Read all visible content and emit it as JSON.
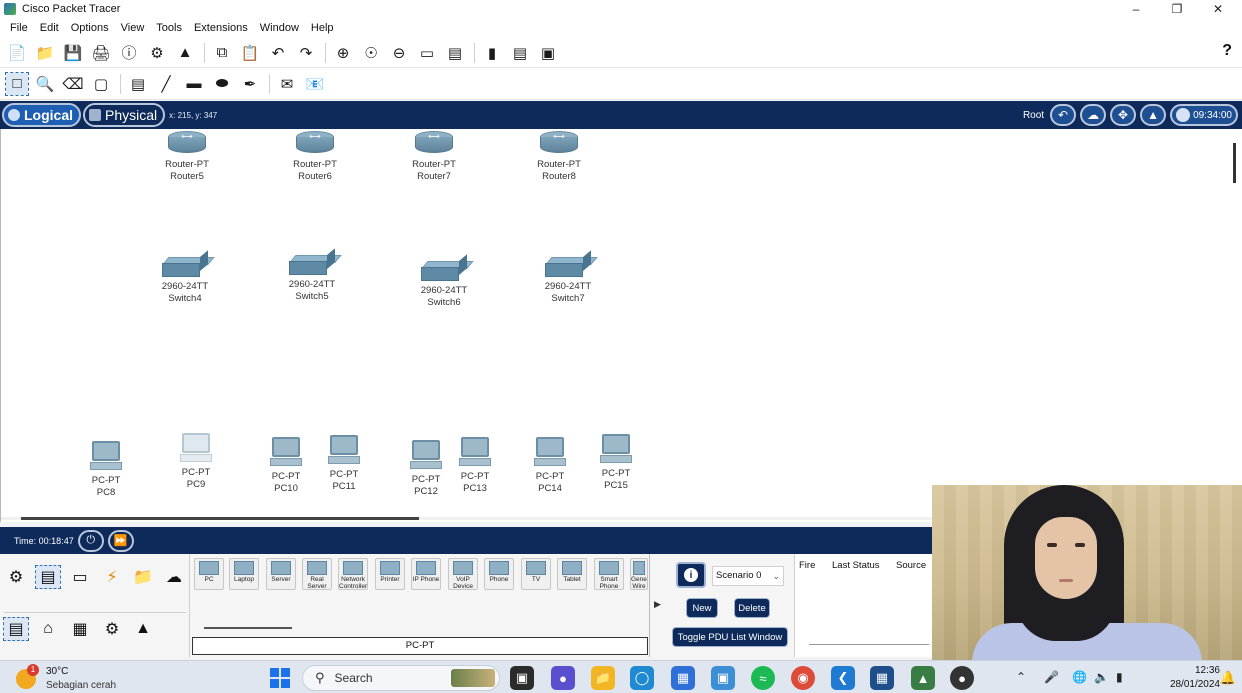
{
  "window": {
    "title": "Cisco Packet Tracer",
    "controls": [
      "–",
      "❐",
      "✕"
    ]
  },
  "menu": [
    "File",
    "Edit",
    "Options",
    "View",
    "Tools",
    "Extensions",
    "Window",
    "Help"
  ],
  "toolbar": {
    "help": "?"
  },
  "logical_bar": {
    "logical_label": "Logical",
    "physical_label": "Physical",
    "coords": "x: 215, y: 347",
    "root_label": "Root",
    "clock": "09:34:00"
  },
  "workspace": {
    "routers": [
      {
        "model": "Router-PT",
        "name": "Router5"
      },
      {
        "model": "Router-PT",
        "name": "Router6"
      },
      {
        "model": "Router-PT",
        "name": "Router7"
      },
      {
        "model": "Router-PT",
        "name": "Router8"
      }
    ],
    "switches": [
      {
        "model": "2960-24TT",
        "name": "Switch4"
      },
      {
        "model": "2960-24TT",
        "name": "Switch5"
      },
      {
        "model": "2960-24TT",
        "name": "Switch6"
      },
      {
        "model": "2960-24TT",
        "name": "Switch7"
      }
    ],
    "pcs": [
      {
        "model": "PC-PT",
        "name": "PC8"
      },
      {
        "model": "PC-PT",
        "name": "PC9"
      },
      {
        "model": "PC-PT",
        "name": "PC10"
      },
      {
        "model": "PC-PT",
        "name": "PC11"
      },
      {
        "model": "PC-PT",
        "name": "PC12"
      },
      {
        "model": "PC-PT",
        "name": "PC13"
      },
      {
        "model": "PC-PT",
        "name": "PC14"
      },
      {
        "model": "PC-PT",
        "name": "PC15"
      }
    ]
  },
  "timebar": {
    "time": "Time: 00:18:47"
  },
  "device_strip": {
    "tiles": [
      "PC",
      "Laptop",
      "Server",
      "Real Server",
      "Network Controller",
      "Printer",
      "IP Phone",
      "VoIP Device",
      "Phone",
      "TV",
      "Tablet",
      "Smart Phone",
      "Generic Wire"
    ],
    "selected_caption": "PC-PT"
  },
  "pdu": {
    "scenario": "Scenario 0",
    "new_label": "New",
    "delete_label": "Delete",
    "toggle_label": "Toggle PDU List Window",
    "columns": [
      "Fire",
      "Last Status",
      "Source"
    ]
  },
  "taskbar": {
    "weather_temp": "30°C",
    "weather_desc": "Sebagian cerah",
    "weather_badge": "1",
    "search_placeholder": "Search",
    "time": "12:36",
    "date": "28/01/2024"
  }
}
